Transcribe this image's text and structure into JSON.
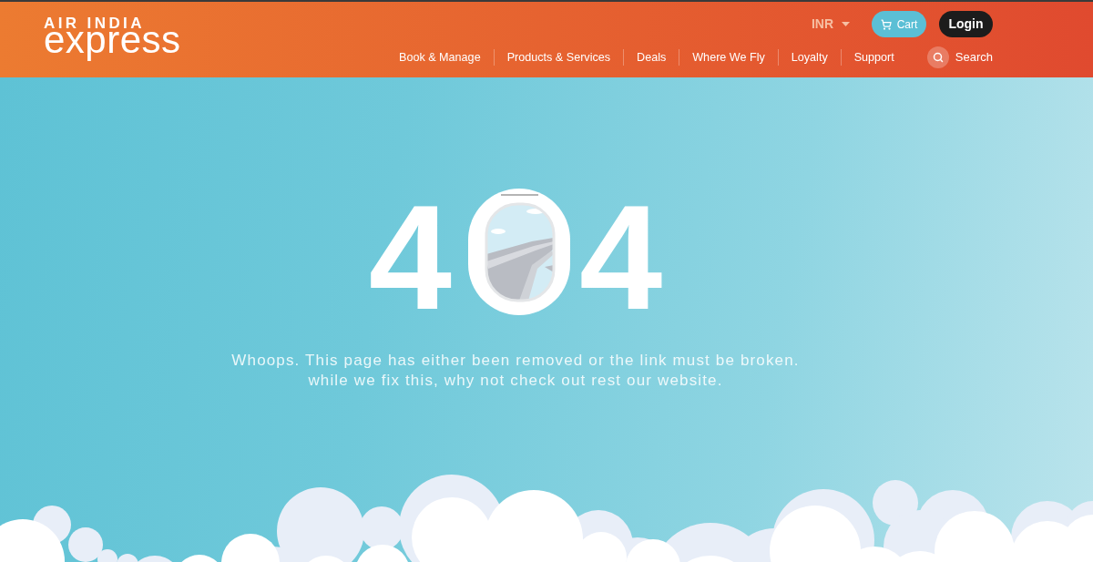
{
  "header": {
    "logo": {
      "line_1": "AIR INDIA",
      "line_2": "express"
    },
    "currency": {
      "label": "INR"
    },
    "cart_button": {
      "label": "Cart"
    },
    "login_button": {
      "label": "Login"
    },
    "nav_items": [
      "Book & Manage",
      "Products & Services",
      "Deals",
      "Where We Fly",
      "Loyalty",
      "Support"
    ],
    "search": {
      "label": "Search"
    }
  },
  "error_page": {
    "code": {
      "first_digit": "4",
      "last_digit": "4"
    },
    "message_lines": [
      "Whoops. This page has either been removed or the link must be broken.",
      "while we fix this, why not check out rest our website."
    ]
  }
}
